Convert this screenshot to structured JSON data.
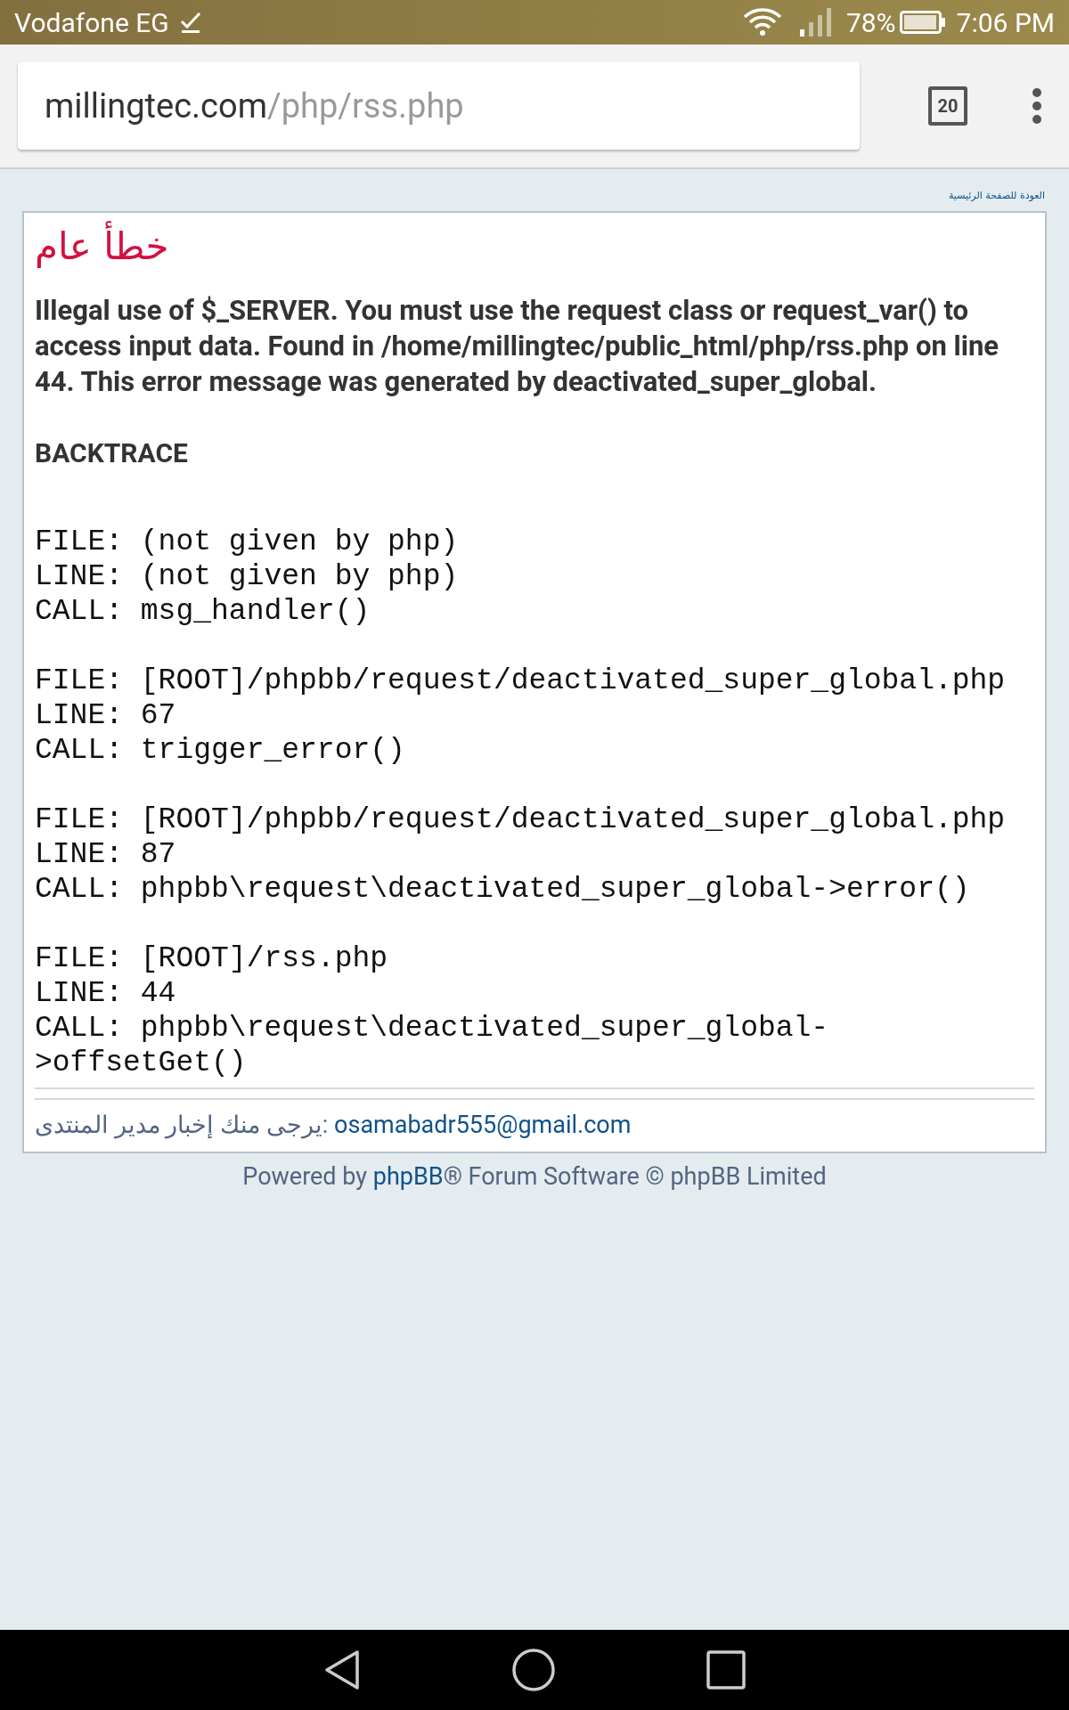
{
  "status_bar": {
    "carrier": "Vodafone EG",
    "battery": "78%",
    "time": "7:06 PM"
  },
  "browser": {
    "url_host": "millingtec.com",
    "url_path": "/php/rss.php",
    "tab_count": "20"
  },
  "page": {
    "home_link": "العودة للصفحة الرئيسية",
    "title": "خطأ عام",
    "message": "Illegal use of $_SERVER. You must use the request class or request_var() to access input data. Found in /home/millingtec/public_html/php/rss.php on line 44. This error message was generated by deactivated_super_global.",
    "backtrace_heading": "BACKTRACE",
    "backtrace": [
      {
        "lines": [
          "FILE: (not given by php)",
          "LINE: (not given by php)",
          "CALL: msg_handler()"
        ]
      },
      {
        "lines": [
          "FILE: [ROOT]/phpbb/request/deactivated_super_global.php",
          "LINE: 67",
          "CALL: trigger_error()"
        ]
      },
      {
        "lines": [
          "FILE: [ROOT]/phpbb/request/deactivated_super_global.php",
          "LINE: 87",
          "CALL: phpbb\\request\\deactivated_super_global->error()"
        ]
      },
      {
        "lines": [
          "FILE: [ROOT]/rss.php",
          "LINE: 44",
          "CALL: phpbb\\request\\deactivated_super_global->offsetGet()"
        ]
      }
    ],
    "contact": {
      "text": "يرجى منك إخبار مدير المنتدى: ",
      "email": "osamabadr555@gmail.com"
    },
    "footer": {
      "before": "Powered by ",
      "link": "phpBB",
      "after": "® Forum Software © phpBB Limited"
    }
  }
}
